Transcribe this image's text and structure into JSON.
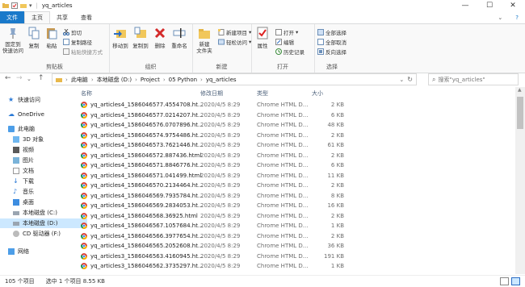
{
  "window": {
    "title": "yq_articles",
    "controls": {
      "minimize": "—",
      "maximize": "☐",
      "close": "✕"
    }
  },
  "tabs": [
    {
      "label": "文件"
    },
    {
      "label": "主页"
    },
    {
      "label": "共享"
    },
    {
      "label": "查看"
    }
  ],
  "ribbon": {
    "clipboard": {
      "pin": "固定到\n快速访问",
      "copy": "复制",
      "paste": "粘贴",
      "cut": "剪切",
      "copy_path": "复制路径",
      "paste_shortcut": "粘贴快捷方式",
      "label": "剪贴板"
    },
    "organize": {
      "move_to": "移动到",
      "copy_to": "复制到",
      "delete": "删除",
      "rename": "重命名",
      "label": "组织"
    },
    "new": {
      "new_folder": "新建\n文件夹",
      "new_item": "新建项目",
      "easy_access": "轻松访问",
      "label": "新建"
    },
    "open": {
      "properties": "属性",
      "open": "打开",
      "edit": "编辑",
      "history": "历史记录",
      "label": "打开"
    },
    "select": {
      "select_all": "全部选择",
      "select_none": "全部取消",
      "invert": "反向选择",
      "label": "选择"
    }
  },
  "address": {
    "crumbs": [
      "此电脑",
      "本地磁盘 (D:)",
      "Project",
      "05 Python",
      "yq_articles"
    ],
    "search_placeholder": "搜索\"yq_articles\""
  },
  "nav": [
    {
      "label": "快速访问",
      "icon": "star-icon"
    },
    {
      "label": "OneDrive",
      "icon": "cloud-icon"
    },
    {
      "label": "此电脑",
      "icon": "computer-icon"
    },
    {
      "label": "3D 对象",
      "icon": "cube-icon"
    },
    {
      "label": "视频",
      "icon": "video-icon"
    },
    {
      "label": "图片",
      "icon": "picture-icon"
    },
    {
      "label": "文档",
      "icon": "document-icon"
    },
    {
      "label": "下载",
      "icon": "download-icon"
    },
    {
      "label": "音乐",
      "icon": "music-icon"
    },
    {
      "label": "桌面",
      "icon": "desktop-icon"
    },
    {
      "label": "本地磁盘 (C:)",
      "icon": "drive-icon"
    },
    {
      "label": "本地磁盘 (D:)",
      "icon": "drive-icon"
    },
    {
      "label": "CD 驱动器 (F:)",
      "icon": "cd-icon"
    },
    {
      "label": "网络",
      "icon": "network-icon"
    }
  ],
  "columns": {
    "name": "名称",
    "date": "修改日期",
    "type": "类型",
    "size": "大小"
  },
  "files": [
    {
      "name": "yq_articles4_1586046577.4554708.ht...",
      "date": "2020/4/5 8:29",
      "type": "Chrome HTML D...",
      "size": "2 KB"
    },
    {
      "name": "yq_articles4_1586046577.0214207.ht...",
      "date": "2020/4/5 8:29",
      "type": "Chrome HTML D...",
      "size": "6 KB"
    },
    {
      "name": "yq_articles4_1586046576.0707896.ht...",
      "date": "2020/4/5 8:29",
      "type": "Chrome HTML D...",
      "size": "48 KB"
    },
    {
      "name": "yq_articles4_1586046574.9754486.ht...",
      "date": "2020/4/5 8:29",
      "type": "Chrome HTML D...",
      "size": "2 KB"
    },
    {
      "name": "yq_articles4_1586046573.7621446.ht...",
      "date": "2020/4/5 8:29",
      "type": "Chrome HTML D...",
      "size": "61 KB"
    },
    {
      "name": "yq_articles4_1586046572.887436.html",
      "date": "2020/4/5 8:29",
      "type": "Chrome HTML D...",
      "size": "2 KB"
    },
    {
      "name": "yq_articles4_1586046571.8846776.ht...",
      "date": "2020/4/5 8:29",
      "type": "Chrome HTML D...",
      "size": "6 KB"
    },
    {
      "name": "yq_articles4_1586046571.041499.html",
      "date": "2020/4/5 8:29",
      "type": "Chrome HTML D...",
      "size": "11 KB"
    },
    {
      "name": "yq_articles4_1586046570.2134464.ht...",
      "date": "2020/4/5 8:29",
      "type": "Chrome HTML D...",
      "size": "2 KB"
    },
    {
      "name": "yq_articles4_1586046569.7935784.ht...",
      "date": "2020/4/5 8:29",
      "type": "Chrome HTML D...",
      "size": "8 KB"
    },
    {
      "name": "yq_articles4_1586046569.2834053.ht...",
      "date": "2020/4/5 8:29",
      "type": "Chrome HTML D...",
      "size": "16 KB"
    },
    {
      "name": "yq_articles4_1586046568.36925.html",
      "date": "2020/4/5 8:29",
      "type": "Chrome HTML D...",
      "size": "2 KB"
    },
    {
      "name": "yq_articles4_1586046567.1057684.ht...",
      "date": "2020/4/5 8:29",
      "type": "Chrome HTML D...",
      "size": "1 KB"
    },
    {
      "name": "yq_articles4_1586046566.3977654.ht...",
      "date": "2020/4/5 8:29",
      "type": "Chrome HTML D...",
      "size": "2 KB"
    },
    {
      "name": "yq_articles4_1586046565.2052608.ht...",
      "date": "2020/4/5 8:29",
      "type": "Chrome HTML D...",
      "size": "36 KB"
    },
    {
      "name": "yq_articles3_1586046563.4160945.ht...",
      "date": "2020/4/5 8:29",
      "type": "Chrome HTML D...",
      "size": "191 KB"
    },
    {
      "name": "yq_articles3_1586046562.3735297.ht...",
      "date": "2020/4/5 8:29",
      "type": "Chrome HTML D...",
      "size": "1 KB"
    }
  ],
  "status": {
    "count": "105 个项目",
    "selected": "选中 1 个项目  8.55 KB"
  },
  "colors": {
    "accent": "#1979ca",
    "selected_nav": "#cce8ff",
    "header_text": "#4c607a"
  }
}
